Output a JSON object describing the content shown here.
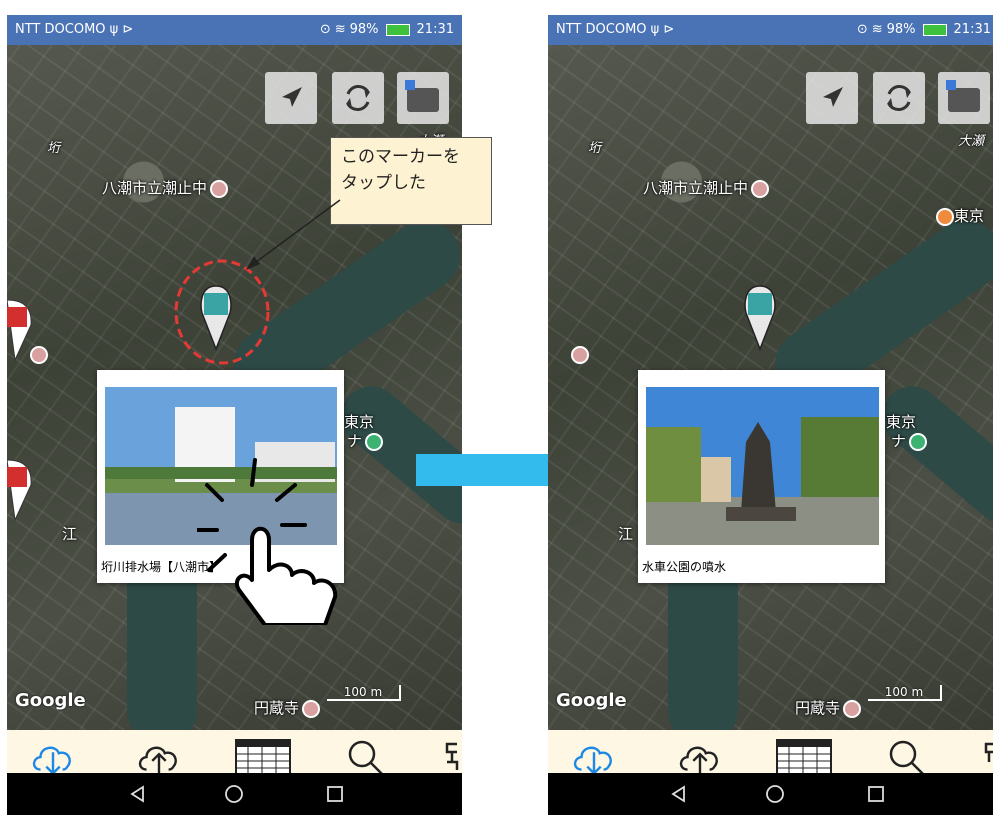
{
  "left": {
    "status": {
      "carrier": "NTT DOCOMO ψ ⊳",
      "battery": "98%",
      "time": "21:31"
    },
    "map_labels": {
      "school": "八潮市立潮止中",
      "oze": "大瀬",
      "kei": "垳",
      "tokyo": "東京",
      "na": "ナ",
      "enzoji": "円蔵寺",
      "e": "江"
    },
    "infowindow": {
      "caption": "垳川排水場【八潮市】"
    },
    "google": "Google",
    "scale": "100 m",
    "callout_lines": [
      "このマーカーを",
      "タップした"
    ]
  },
  "right": {
    "status": {
      "carrier": "NTT DOCOMO ψ ⊳",
      "battery": "98%",
      "time": "21:31"
    },
    "map_labels": {
      "school": "八潮市立潮止中",
      "oze": "大瀬",
      "kei": "垳",
      "tokyo": "東京",
      "tokyo2": "東京",
      "na": "ナ",
      "enzoji": "円蔵寺",
      "e": "江"
    },
    "infowindow": {
      "caption": "水車公園の噴水"
    },
    "google": "Google",
    "scale": "100 m"
  },
  "icons": {
    "my_location": "navigation-arrow-icon",
    "refresh": "refresh-icon",
    "layer": "map-layer-icon",
    "download": "cloud-download-icon",
    "upload": "cloud-upload-icon",
    "table": "table-icon",
    "search": "search-icon",
    "more": "more-icon",
    "back": "back-icon",
    "home": "home-icon",
    "recents": "recents-icon"
  },
  "colors": {
    "statusbar": "#4a73b6",
    "toolbar": "#fdf7e4",
    "accent_blue": "#1e88e5",
    "arrow": "#33bbee",
    "tap_circle": "#e53935"
  }
}
